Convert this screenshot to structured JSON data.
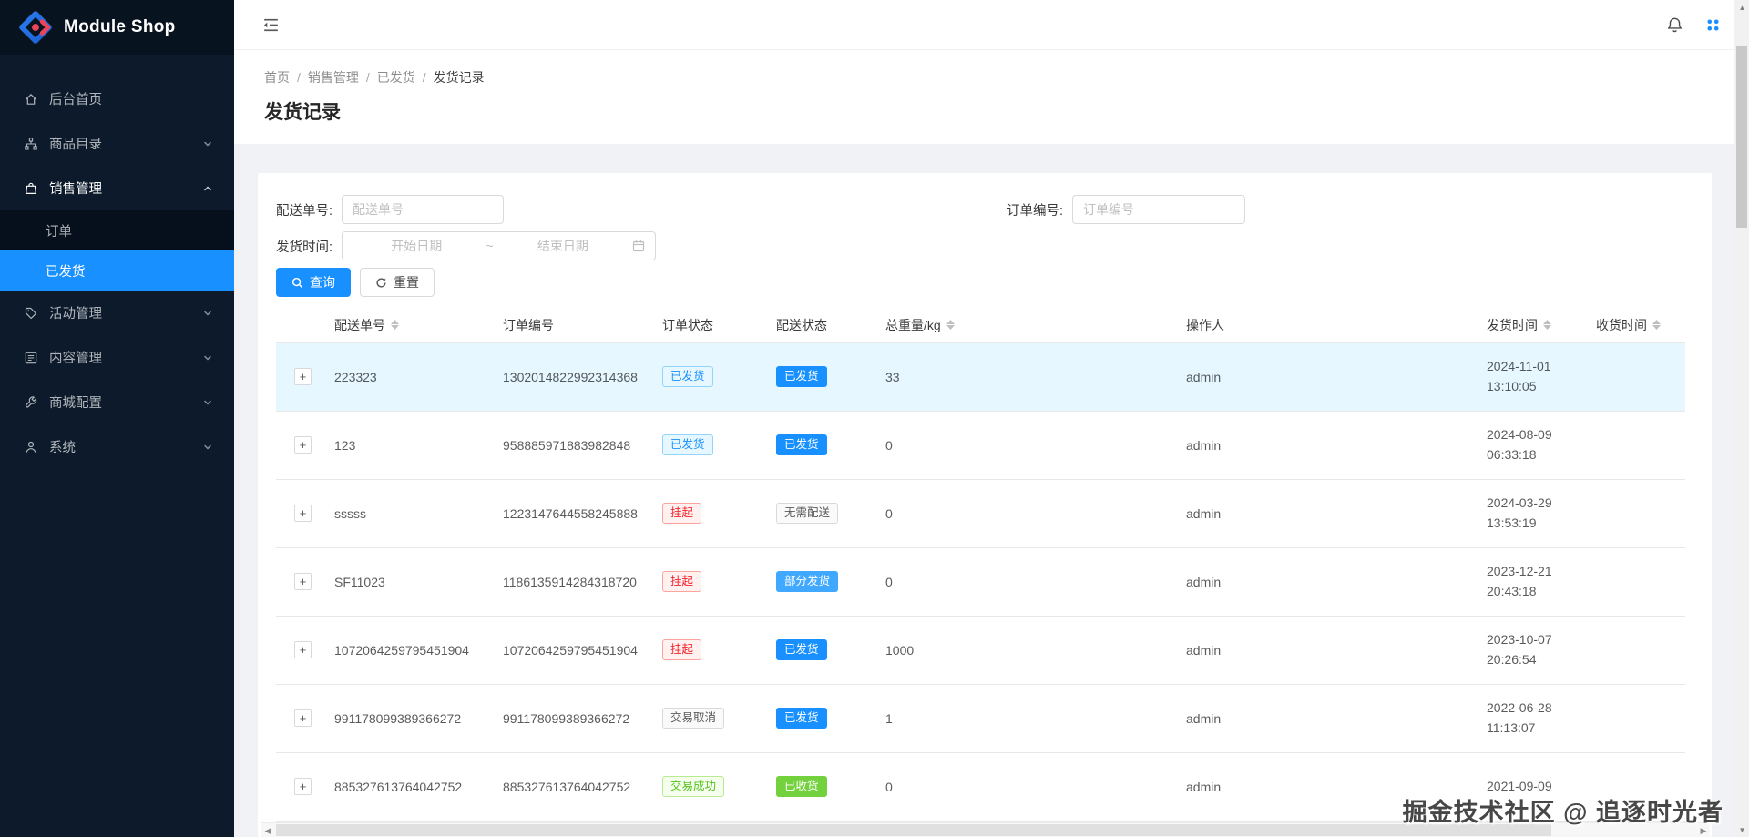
{
  "app": {
    "name": "Module Shop"
  },
  "topbar": {
    "icons": [
      "menu-fold-icon",
      "bell-icon",
      "apps-icon"
    ]
  },
  "breadcrumb": {
    "separator": "/",
    "items": [
      "首页",
      "销售管理",
      "已发货",
      "发货记录"
    ]
  },
  "page_title": "发货记录",
  "sidebar": {
    "items": [
      {
        "key": "home",
        "icon": "home",
        "label": "后台首页",
        "expandable": false
      },
      {
        "key": "catalog",
        "icon": "catalog",
        "label": "商品目录",
        "expandable": true
      },
      {
        "key": "sales",
        "icon": "sales",
        "label": "销售管理",
        "expandable": true,
        "expanded": true,
        "children": [
          {
            "key": "orders",
            "label": "订单",
            "active": false
          },
          {
            "key": "shipped",
            "label": "已发货",
            "active": true
          }
        ]
      },
      {
        "key": "activity",
        "icon": "activity",
        "label": "活动管理",
        "expandable": true
      },
      {
        "key": "content",
        "icon": "content",
        "label": "内容管理",
        "expandable": true
      },
      {
        "key": "mall-config",
        "icon": "config",
        "label": "商城配置",
        "expandable": true
      },
      {
        "key": "system",
        "icon": "system",
        "label": "系统",
        "expandable": true
      }
    ]
  },
  "filters": {
    "delivery_no": {
      "label": "配送单号:",
      "placeholder": "配送单号",
      "value": ""
    },
    "order_no": {
      "label": "订单编号:",
      "placeholder": "订单编号",
      "value": ""
    },
    "ship_time": {
      "label": "发货时间:",
      "start_placeholder": "开始日期",
      "separator": "~",
      "end_placeholder": "结束日期"
    },
    "search_label": "查询",
    "reset_label": "重置"
  },
  "table": {
    "columns": [
      {
        "key": "expand",
        "label": "",
        "sortable": false
      },
      {
        "key": "delivery-no",
        "label": "配送单号",
        "sortable": true
      },
      {
        "key": "order-no",
        "label": "订单编号",
        "sortable": false
      },
      {
        "key": "order-status",
        "label": "订单状态",
        "sortable": false
      },
      {
        "key": "delivery-status",
        "label": "配送状态",
        "sortable": false
      },
      {
        "key": "weight",
        "label": "总重量/kg",
        "sortable": true
      },
      {
        "key": "operator",
        "label": "操作人",
        "sortable": false
      },
      {
        "key": "ship-time",
        "label": "发货时间",
        "sortable": true
      },
      {
        "key": "receive-time",
        "label": "收货时间",
        "sortable": true
      }
    ],
    "rows": [
      {
        "delivery_no": "223323",
        "order_no": "1302014822992314368",
        "order_status": {
          "text": "已发货",
          "type": "blue-outline"
        },
        "delivery_status": {
          "text": "已发货",
          "type": "blue-solid"
        },
        "weight": "33",
        "operator": "admin",
        "ship_date": "2024-11-01",
        "ship_clock": "13:10:05",
        "receive_time": "",
        "highlighted": true
      },
      {
        "delivery_no": "123",
        "order_no": "958885971883982848",
        "order_status": {
          "text": "已发货",
          "type": "blue-outline"
        },
        "delivery_status": {
          "text": "已发货",
          "type": "blue-solid"
        },
        "weight": "0",
        "operator": "admin",
        "ship_date": "2024-08-09",
        "ship_clock": "06:33:18",
        "receive_time": "",
        "highlighted": false
      },
      {
        "delivery_no": "sssss",
        "order_no": "1223147644558245888",
        "order_status": {
          "text": "挂起",
          "type": "red-outline"
        },
        "delivery_status": {
          "text": "无需配送",
          "type": "default-outline"
        },
        "weight": "0",
        "operator": "admin",
        "ship_date": "2024-03-29",
        "ship_clock": "13:53:19",
        "receive_time": "",
        "highlighted": false
      },
      {
        "delivery_no": "SF11023",
        "order_no": "1186135914284318720",
        "order_status": {
          "text": "挂起",
          "type": "red-outline"
        },
        "delivery_status": {
          "text": "部分发货",
          "type": "lightblue-solid"
        },
        "weight": "0",
        "operator": "admin",
        "ship_date": "2023-12-21",
        "ship_clock": "20:43:18",
        "receive_time": "",
        "highlighted": false
      },
      {
        "delivery_no": "1072064259795451904",
        "order_no": "1072064259795451904",
        "order_status": {
          "text": "挂起",
          "type": "red-outline"
        },
        "delivery_status": {
          "text": "已发货",
          "type": "blue-solid"
        },
        "weight": "1000",
        "operator": "admin",
        "ship_date": "2023-10-07",
        "ship_clock": "20:26:54",
        "receive_time": "",
        "highlighted": false
      },
      {
        "delivery_no": "991178099389366272",
        "order_no": "991178099389366272",
        "order_status": {
          "text": "交易取消",
          "type": "default-outline"
        },
        "delivery_status": {
          "text": "已发货",
          "type": "blue-solid"
        },
        "weight": "1",
        "operator": "admin",
        "ship_date": "2022-06-28",
        "ship_clock": "11:13:07",
        "receive_time": "",
        "highlighted": false
      },
      {
        "delivery_no": "885327613764042752",
        "order_no": "885327613764042752",
        "order_status": {
          "text": "交易成功",
          "type": "green-outline"
        },
        "delivery_status": {
          "text": "已收货",
          "type": "green-solid"
        },
        "weight": "0",
        "operator": "admin",
        "ship_date": "2021-09-09",
        "ship_clock": "",
        "receive_time": "",
        "highlighted": false
      }
    ]
  },
  "watermark": "掘金技术社区 @ 追逐时光者",
  "colors": {
    "accent": "#1890ff",
    "page_bg": "#f0f2f5",
    "sidebar_bg": "#0c1a2b",
    "sidebar_logo_bg": "#081320",
    "sidebar_submenu_bg": "#05101c",
    "active_item": "#1890ff",
    "row_highlight": "#e6f7ff",
    "status_blue": "#1890ff",
    "status_lightblue": "#40a9ff",
    "status_green_solid": "#73d13d",
    "status_red": "#f5222d",
    "status_green": "#52c41a",
    "logo_red": "#e8455a",
    "logo_blue": "#2a7cf0"
  }
}
